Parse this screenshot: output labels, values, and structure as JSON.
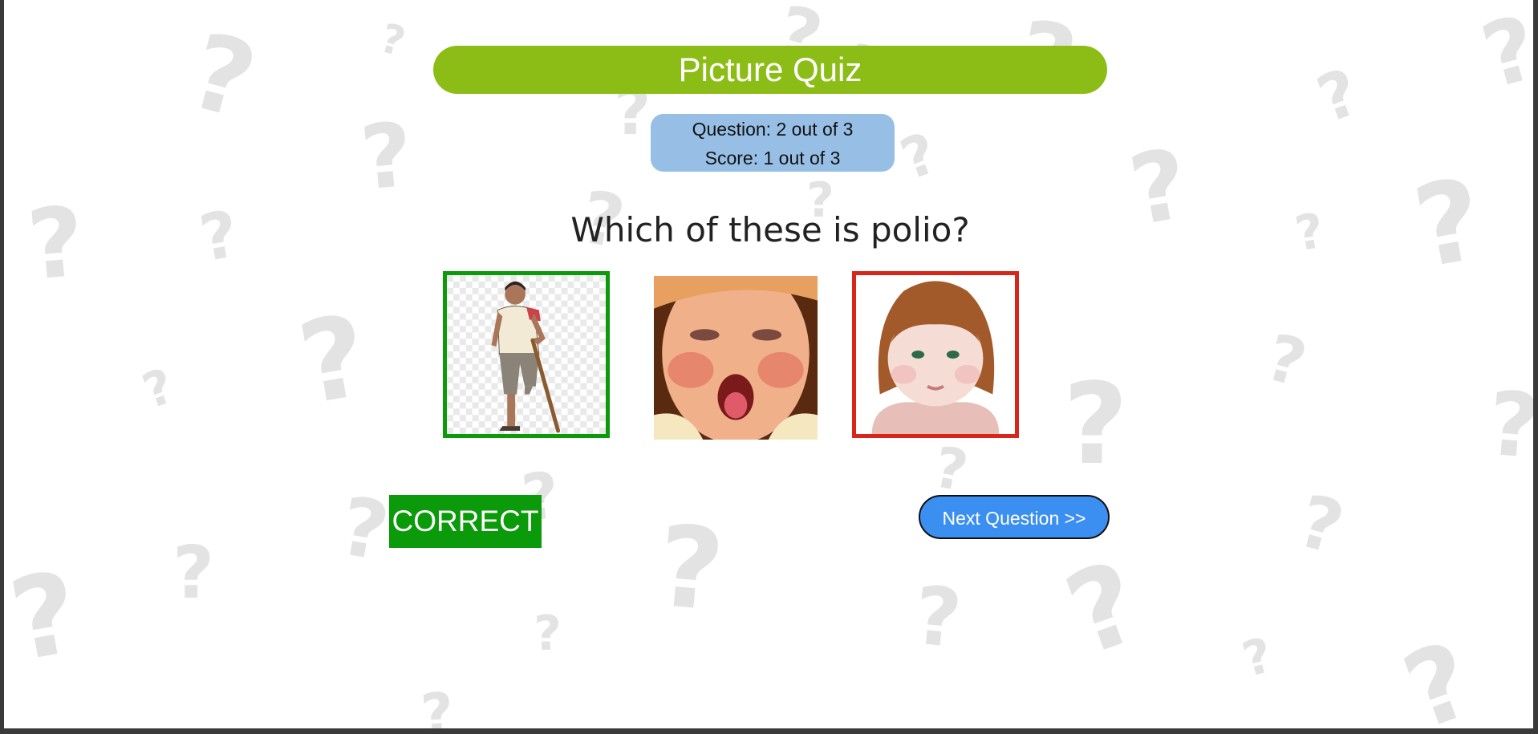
{
  "app": {
    "title": "Picture Quiz",
    "accent_color": "#8cbd16"
  },
  "status": {
    "question": "Question: 2 out of 3",
    "score": "Score: 1 out of 3",
    "background": "#97bfe6"
  },
  "question": {
    "text": "Which of these is polio?"
  },
  "choices": [
    {
      "image": "man-with-crutch-image",
      "state": "correct",
      "border_color": "#0a9a0a"
    },
    {
      "image": "child-coughing-image",
      "state": "unselected"
    },
    {
      "image": "girl-swollen-face-image",
      "state": "wrong",
      "border_color": "#d8261a"
    }
  ],
  "result": {
    "label": "CORRECT",
    "color": "#0a9a0a"
  },
  "next_button": {
    "label": "Next Question >>",
    "color": "#3b8ff0"
  },
  "background": {
    "pattern_icon": "question-mark-icon"
  }
}
